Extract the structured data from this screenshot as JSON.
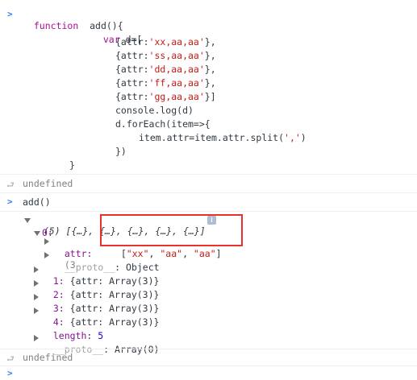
{
  "console": {
    "code_block": {
      "prompt": ">",
      "lines": [
        {
          "kw": "function",
          "rest": "  add(){"
        },
        {
          "kw": "var",
          "rest": " d=["
        },
        {
          "text": "{attr:'xx,aa,aa'},"
        },
        {
          "text": "{attr:'ss,aa,aa'},"
        },
        {
          "text": "{attr:'dd,aa,aa'},"
        },
        {
          "text": "{attr:'ff,aa,aa'},"
        },
        {
          "text": "{attr:'gg,aa,aa'}]"
        },
        {
          "text": "console.log(d)"
        },
        {
          "text": "d.forEach(item=>{"
        },
        {
          "text": "item.attr=item.attr.split(',')"
        },
        {
          "text": "})"
        },
        {
          "text": "}"
        }
      ]
    },
    "result1": "undefined",
    "command2": "add()",
    "log": {
      "summary": "(5) [{…}, {…}, {…}, {…}, {…}]",
      "info_icon": "i",
      "item0": {
        "index": "0:",
        "attr_key": "attr:",
        "attr_preview": "(3",
        "attr_value": "[\"xx\", \"aa\", \"aa\"]",
        "proto_key": "__proto__",
        "proto_value": ": Object"
      },
      "items": [
        {
          "index": "1:",
          "value": "{attr: Array(3)}"
        },
        {
          "index": "2:",
          "value": "{attr: Array(3)}"
        },
        {
          "index": "3:",
          "value": "{attr: Array(3)}"
        },
        {
          "index": "4:",
          "value": "{attr: Array(3)}"
        }
      ],
      "length_key": "length",
      "length_value": "5",
      "proto_key": "__proto__",
      "proto_value": "Array(0)"
    },
    "result2": "undefined",
    "input_prompt": ">"
  },
  "colors": {
    "keyword": "#aa0d91",
    "string": "#c41a16",
    "number": "#1c00cf",
    "property": "#881391",
    "prompt": "#367cf1",
    "highlight": "#e8322e"
  }
}
